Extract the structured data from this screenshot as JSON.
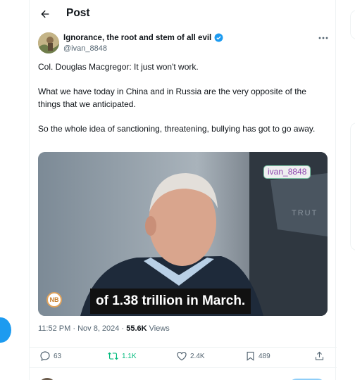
{
  "header": {
    "title": "Post"
  },
  "post": {
    "author_name": "Ignorance, the root and stem of all evil",
    "handle": "@ivan_8848",
    "paragraphs": [
      "Col. Douglas Macgregor: It just won't work.",
      "What we have today in China and in Russia are the very opposite of the things that we anticipated.",
      "So the whole idea of sanctioning, threatening, bullying has got to go away."
    ],
    "media": {
      "watermark": "ivan_8848",
      "caption": "of 1.38 trillion in March.",
      "logo_text": "NB",
      "background_text": "TRUT"
    },
    "time": "11:52 PM",
    "date": "Nov 8, 2024",
    "separator": "·",
    "views_count": "55.6K",
    "views_label": "Views"
  },
  "actions": {
    "replies": "63",
    "reposts": "1.1K",
    "likes": "2.4K",
    "bookmarks": "489"
  },
  "colors": {
    "accent": "#1d9bf0",
    "repost": "#00ba7c",
    "secondary_text": "#536471"
  }
}
